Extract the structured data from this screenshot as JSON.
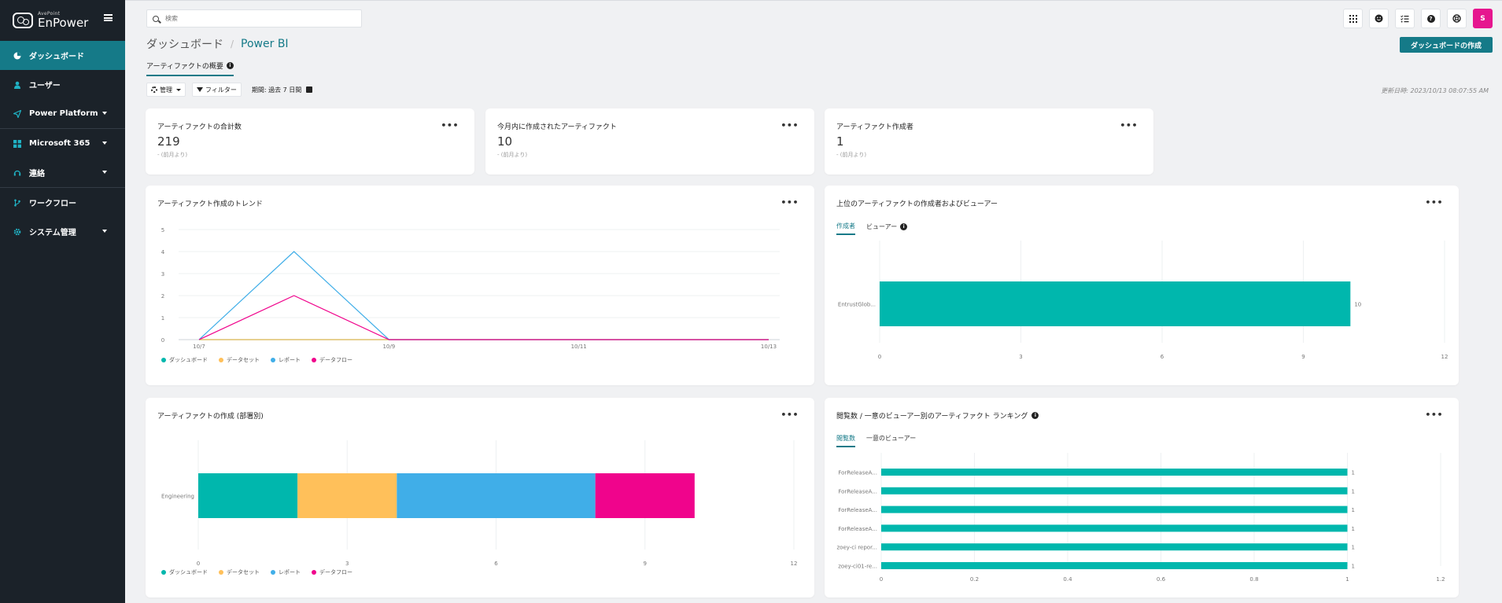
{
  "brand": {
    "sub": "AvePoint",
    "name": "EnPower"
  },
  "sidebar": {
    "items": [
      {
        "label": "ダッシュボード",
        "active": true,
        "caret": false
      },
      {
        "label": "ユーザー",
        "active": false,
        "caret": false
      },
      {
        "label": "Power Platform",
        "active": false,
        "caret": true
      },
      {
        "label": "Microsoft 365",
        "active": false,
        "caret": true
      },
      {
        "label": "連絡",
        "active": false,
        "caret": true
      },
      {
        "label": "ワークフロー",
        "active": false,
        "caret": false
      },
      {
        "label": "システム管理",
        "active": false,
        "caret": true
      }
    ]
  },
  "search": {
    "placeholder": "検索"
  },
  "avatar": {
    "initial": "S"
  },
  "breadcrumb": {
    "root": "ダッシュボード",
    "separator": "/",
    "current": "Power BI"
  },
  "create_button": "ダッシュボードの作成",
  "subtab": {
    "label": "アーティファクトの概要"
  },
  "toolbar": {
    "manage": "管理",
    "filter": "フィルター",
    "period": "期間: 過去 7 日間"
  },
  "updated": "更新日時: 2023/10/13 08:07:55 AM",
  "stats": [
    {
      "title": "アーティファクトの合計数",
      "value": "219",
      "sub": "- (前月より)"
    },
    {
      "title": "今月内に作成されたアーティファクト",
      "value": "10",
      "sub": "- (前月より)"
    },
    {
      "title": "アーティファクト作成者",
      "value": "1",
      "sub": "- (前月より)"
    }
  ],
  "menu_glyph": "•••",
  "legend": [
    "ダッシュボード",
    "データセット",
    "レポート",
    "データフロー"
  ],
  "colors": {
    "teal": "#00b7ad",
    "yellow": "#ffc05a",
    "blue": "#40aee8",
    "pink": "#f0048c",
    "accent": "#157a88"
  },
  "chart_data": [
    {
      "type": "line",
      "title": "アーティファクト作成のトレンド",
      "x": [
        "10/7",
        "10/8",
        "10/9",
        "10/10",
        "10/11",
        "10/12",
        "10/13"
      ],
      "x_tick_labels": [
        "10/7",
        "10/9",
        "10/11",
        "10/13"
      ],
      "ylim": [
        0,
        5
      ],
      "yticks": [
        0,
        1,
        2,
        3,
        4,
        5
      ],
      "series": [
        {
          "name": "ダッシュボード",
          "values": [
            0,
            0,
            0,
            0,
            0,
            0,
            0
          ]
        },
        {
          "name": "データセット",
          "values": [
            0,
            0,
            0,
            0,
            0,
            0,
            0
          ]
        },
        {
          "name": "レポート",
          "values": [
            0,
            4,
            0,
            0,
            0,
            0,
            0
          ]
        },
        {
          "name": "データフロー",
          "values": [
            0,
            2,
            0,
            0,
            0,
            0,
            0
          ]
        }
      ],
      "legend": "bottom-left"
    },
    {
      "type": "bar",
      "orientation": "horizontal",
      "title": "上位のアーティファクトの作成者およびビューアー",
      "tabs": [
        "作成者",
        "ビューアー"
      ],
      "categories": [
        "EntrustGlob..."
      ],
      "values": [
        10
      ],
      "data_labels": [
        "10"
      ],
      "xlim": [
        0,
        12
      ],
      "xticks": [
        0,
        3,
        6,
        9,
        12
      ]
    },
    {
      "type": "bar",
      "orientation": "horizontal",
      "stacked": true,
      "title": "アーティファクトの作成 (部署別)",
      "categories": [
        "Engineering"
      ],
      "series": [
        {
          "name": "ダッシュボード",
          "values": [
            2
          ]
        },
        {
          "name": "データセット",
          "values": [
            2
          ]
        },
        {
          "name": "レポート",
          "values": [
            4
          ]
        },
        {
          "name": "データフロー",
          "values": [
            2
          ]
        }
      ],
      "xlim": [
        0,
        12
      ],
      "xticks": [
        0,
        3,
        6,
        9,
        12
      ],
      "legend": "bottom-left"
    },
    {
      "type": "bar",
      "orientation": "horizontal",
      "title": "閲覧数 / 一意のビューアー別のアーティファクト ランキング",
      "tabs": [
        "閲覧数",
        "一意のビューアー"
      ],
      "categories": [
        "ForReleaseA...",
        "ForReleaseA...",
        "ForReleaseA...",
        "ForReleaseA...",
        "zoey-ci repor...",
        "zoey-ci01-re..."
      ],
      "values": [
        1,
        1,
        1,
        1,
        1,
        1
      ],
      "data_labels": [
        "1",
        "1",
        "1",
        "1",
        "1",
        "1"
      ],
      "xlim": [
        0,
        1.2
      ],
      "xticks": [
        "0",
        "0.2",
        "0.4",
        "0.6",
        "0.8",
        "1",
        "1.2"
      ]
    }
  ]
}
